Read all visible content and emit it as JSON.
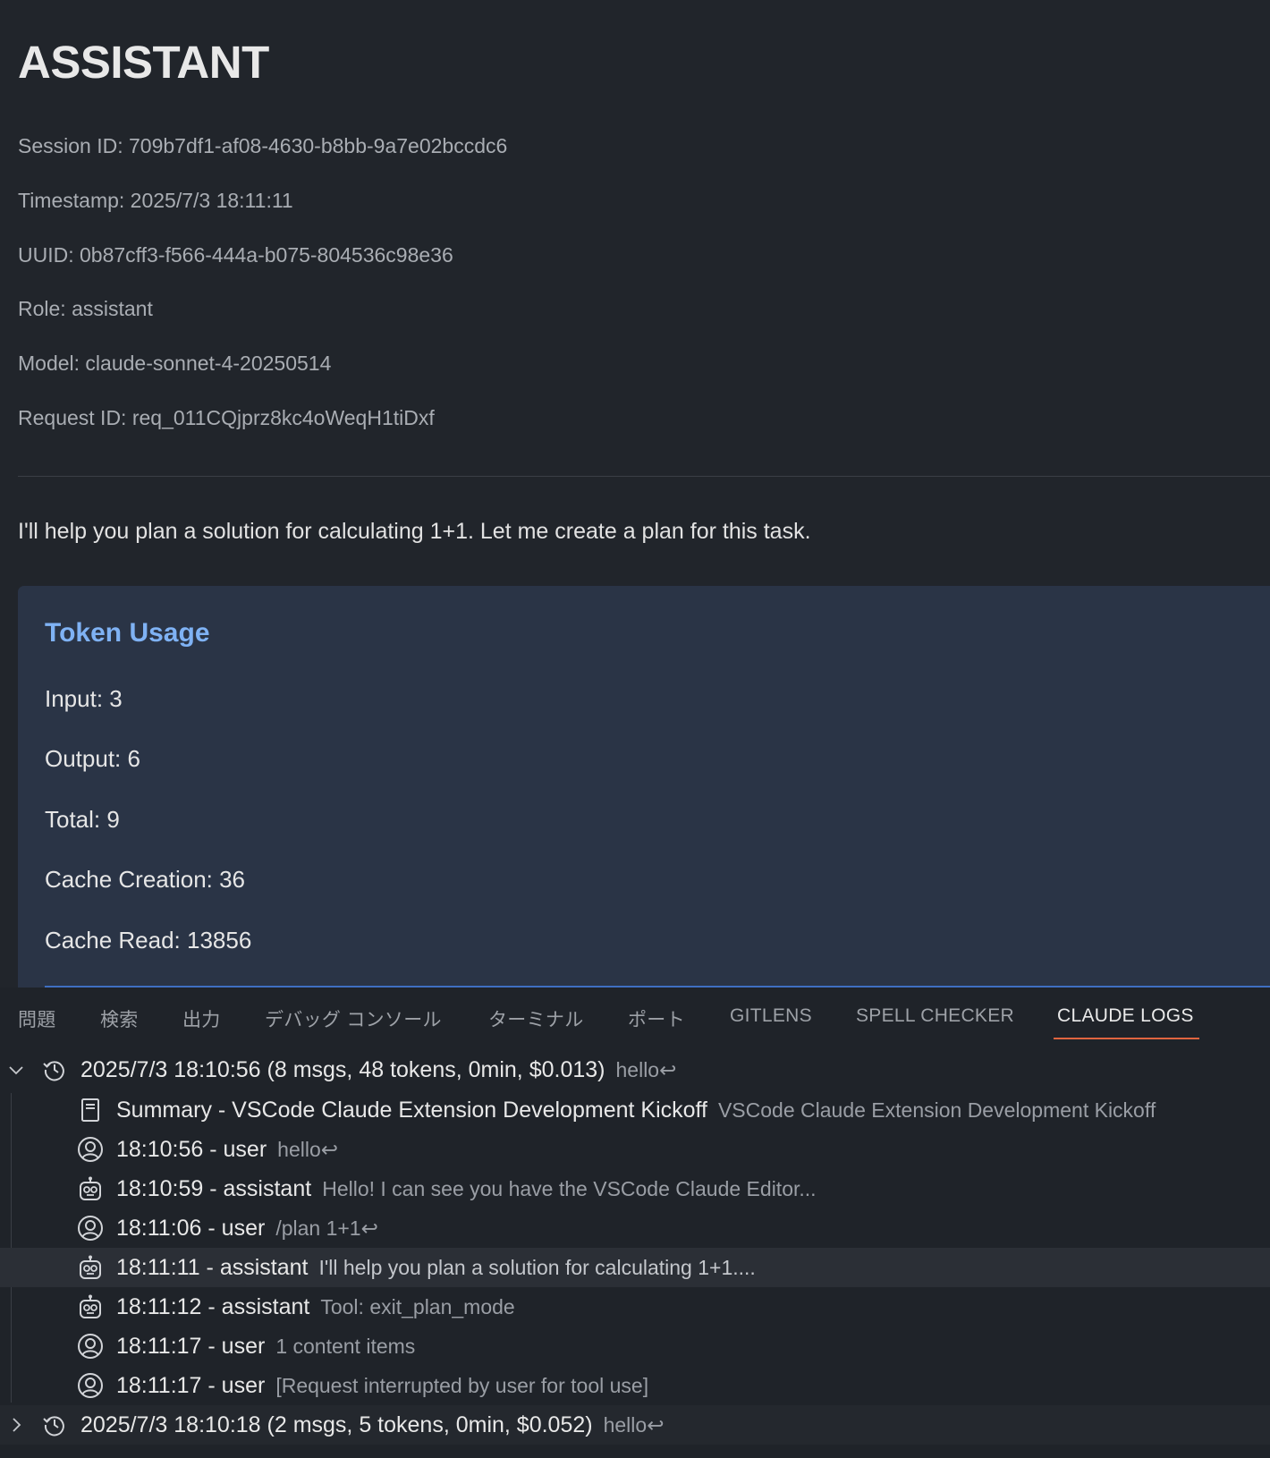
{
  "webview": {
    "title": "ASSISTANT",
    "meta": [
      "Session ID: 709b7df1-af08-4630-b8bb-9a7e02bccdc6",
      "Timestamp: 2025/7/3 18:11:11",
      "UUID: 0b87cff3-f566-444a-b075-804536c98e36",
      "Role: assistant",
      "Model: claude-sonnet-4-20250514",
      "Request ID: req_011CQjprz8kc4oWeqH1tiDxf"
    ],
    "message": "I'll help you plan a solution for calculating 1+1. Let me create a plan for this task.",
    "token_usage": {
      "heading": "Token Usage",
      "rows": [
        "Input: 3",
        "Output: 6",
        "Total: 9",
        "Cache Creation: 36",
        "Cache Read: 13856"
      ]
    }
  },
  "panel": {
    "tabs": [
      "問題",
      "検索",
      "出力",
      "デバッグ コンソール",
      "ターミナル",
      "ポート",
      "GITLENS",
      "SPELL CHECKER",
      "CLAUDE LOGS"
    ],
    "active_tab": "CLAUDE LOGS",
    "sessions": [
      {
        "label": "2025/7/3 18:10:56 (8 msgs, 48 tokens, 0min, $0.013)",
        "preview": "hello↩",
        "expanded": true,
        "icon": "history-icon",
        "children": [
          {
            "icon": "summary-icon",
            "label": "Summary - VSCode Claude Extension Development Kickoff",
            "detail": "VSCode Claude Extension Development Kickoff"
          },
          {
            "icon": "user-icon",
            "label": "18:10:56 - user",
            "detail": "hello↩"
          },
          {
            "icon": "robot-icon",
            "label": "18:10:59 - assistant",
            "detail": "Hello! I can see you have the VSCode Claude Editor..."
          },
          {
            "icon": "user-icon",
            "label": "18:11:06 - user",
            "detail": "/plan 1+1↩"
          },
          {
            "icon": "robot-icon",
            "label": "18:11:11 - assistant",
            "detail": "I'll help you plan a solution for calculating 1+1....",
            "selected": true
          },
          {
            "icon": "robot-icon",
            "label": "18:11:12 - assistant",
            "detail": "Tool: exit_plan_mode"
          },
          {
            "icon": "user-icon",
            "label": "18:11:17 - user",
            "detail": "1 content items"
          },
          {
            "icon": "user-icon",
            "label": "18:11:17 - user",
            "detail": "[Request interrupted by user for tool use]"
          }
        ]
      },
      {
        "label": "2025/7/3 18:10:18 (2 msgs, 5 tokens, 0min, $0.052)",
        "preview": "hello↩",
        "expanded": false,
        "icon": "history-icon"
      }
    ]
  },
  "colors": {
    "editor_bg": "#21252b",
    "panel_bg": "#1f2329",
    "token_box_bg": "#2a3446",
    "token_heading": "#7fb2f4",
    "active_tab_underline": "#e0643f"
  }
}
